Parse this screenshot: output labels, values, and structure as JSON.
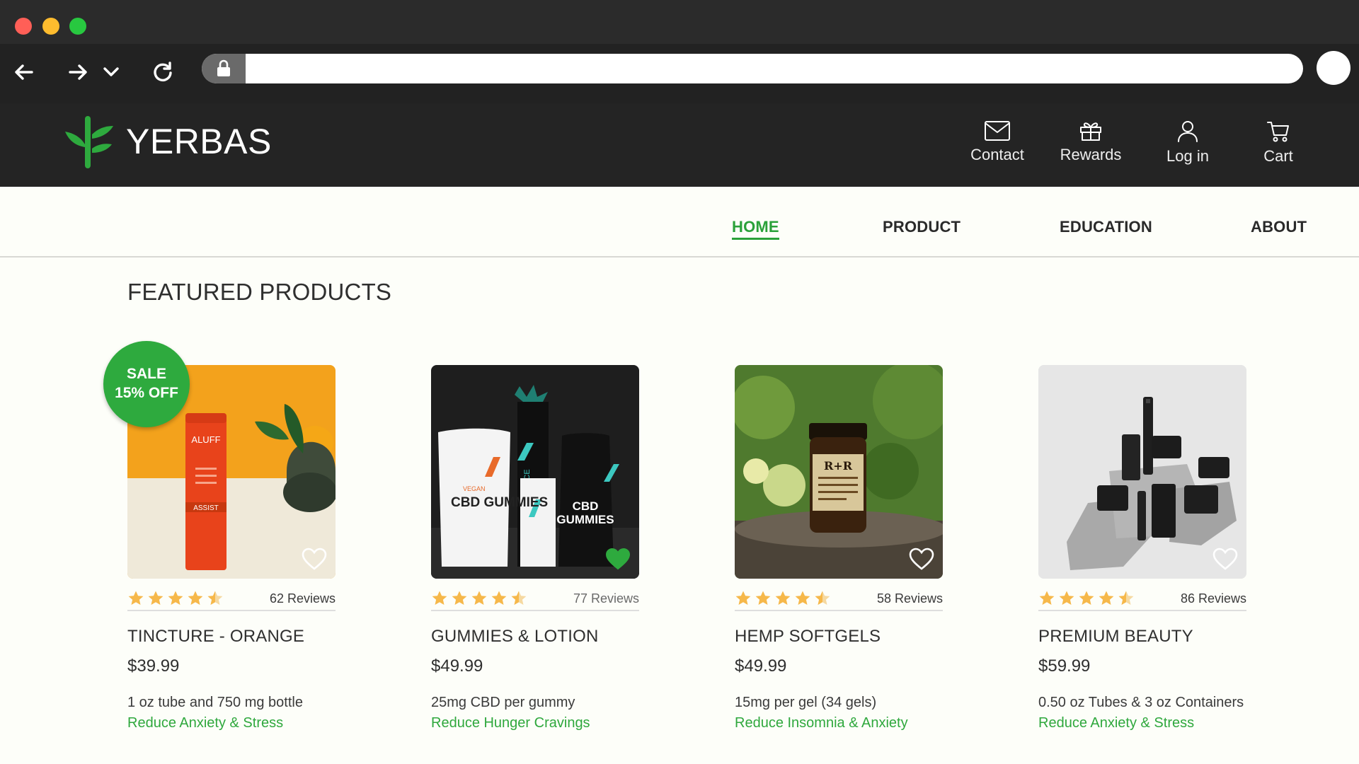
{
  "browser": {
    "url_value": "",
    "icons": [
      "back-arrow-icon",
      "forward-arrow-icon",
      "chevron-down-icon",
      "reload-icon",
      "lock-icon"
    ]
  },
  "site": {
    "brand": "YERBAS",
    "brand_color": "#2eaa3e",
    "header_links": [
      {
        "label": "Contact",
        "icon": "envelope-icon"
      },
      {
        "label": "Rewards",
        "icon": "gift-icon"
      },
      {
        "label": "Log in",
        "icon": "user-icon"
      },
      {
        "label": "Cart",
        "icon": "cart-icon"
      }
    ],
    "nav": [
      {
        "label": "HOME",
        "active": true
      },
      {
        "label": "PRODUCT",
        "active": false
      },
      {
        "label": "EDUCATION",
        "active": false
      },
      {
        "label": "ABOUT",
        "active": false
      }
    ]
  },
  "featured": {
    "title": "FEATURED PRODUCTS",
    "sale_badge": {
      "line1": "SALE",
      "line2": "15% OFF"
    },
    "products": [
      {
        "name": "TINCTURE - ORANGE",
        "price": "$39.99",
        "rating": 4.5,
        "reviews": "62 Reviews",
        "description": "1 oz tube and 750 mg bottle",
        "benefit": "Reduce  Anxiety & Stress",
        "favorited": false,
        "image_label": "ALUFF",
        "image_sublabel": "ASSIST"
      },
      {
        "name": "GUMMIES & LOTION",
        "price": "$49.99",
        "rating": 4.5,
        "reviews": "77 Reviews",
        "description": "25mg CBD per gummy",
        "benefit": "Reduce Hunger Cravings",
        "favorited": true,
        "image_label": "CBD GUMMIES",
        "image_sublabel": "RESILIENCE"
      },
      {
        "name": "HEMP SOFTGELS",
        "price": "$49.99",
        "rating": 4.5,
        "reviews": "58 Reviews",
        "description": "15mg per gel (34 gels)",
        "benefit": "Reduce Insomnia & Anxiety",
        "favorited": false,
        "image_label": "R+R",
        "image_sublabel": ""
      },
      {
        "name": "PREMIUM BEAUTY",
        "price": "$59.99",
        "rating": 4.5,
        "reviews": "86 Reviews",
        "description": "0.50 oz Tubes & 3 oz Containers",
        "benefit": "Reduce Anxiety & Stress",
        "favorited": false,
        "image_label": "",
        "image_sublabel": ""
      }
    ]
  }
}
